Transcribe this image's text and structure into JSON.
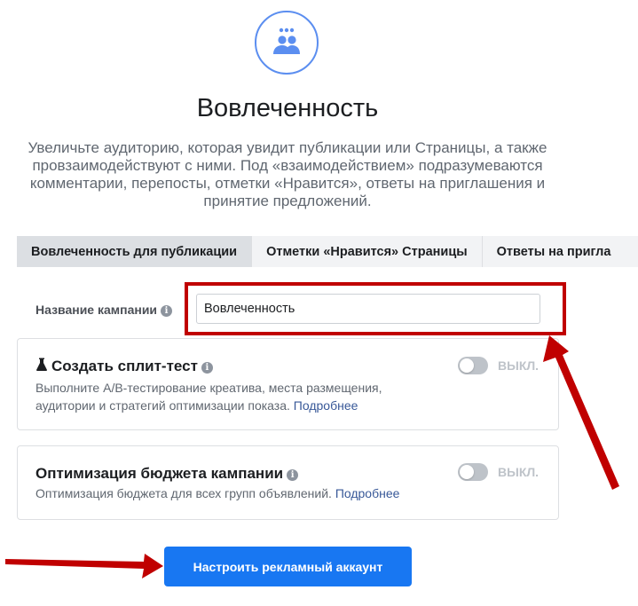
{
  "header": {
    "icon": "people-group-icon",
    "title": "Вовлеченность",
    "description": "Увеличьте аудиторию, которая увидит публикации или Страницы, а также провзаимодействуют с ними. Под «взаимодействием» подразумеваются комментарии, перепосты, отметки «Нравится», ответы на приглашения и принятие предложений."
  },
  "tabs": [
    {
      "label": "Вовлеченность для публикации",
      "active": true
    },
    {
      "label": "Отметки «Нравится» Страницы",
      "active": false
    },
    {
      "label": "Ответы на пригла",
      "active": false
    }
  ],
  "campaign_name": {
    "label": "Название кампании",
    "info_icon": "info-icon",
    "value": "Вовлеченность"
  },
  "split_test": {
    "icon": "flask-icon",
    "title": "Создать сплит-тест",
    "description": "Выполните A/B-тестирование креатива, места размещения, аудитории и стратегий оптимизации показа.",
    "link": "Подробнее",
    "toggle_label": "ВЫКЛ."
  },
  "budget_optimization": {
    "title": "Оптимизация бюджета кампании",
    "description": "Оптимизация бюджета для всех групп объявлений.",
    "link": "Подробнее",
    "toggle_label": "ВЫКЛ."
  },
  "actions": {
    "setup_button": "Настроить рекламный аккаунт"
  },
  "colors": {
    "accent": "#1877f2",
    "annotation_red": "#c00000",
    "icon_blue": "#5b8ef0"
  }
}
